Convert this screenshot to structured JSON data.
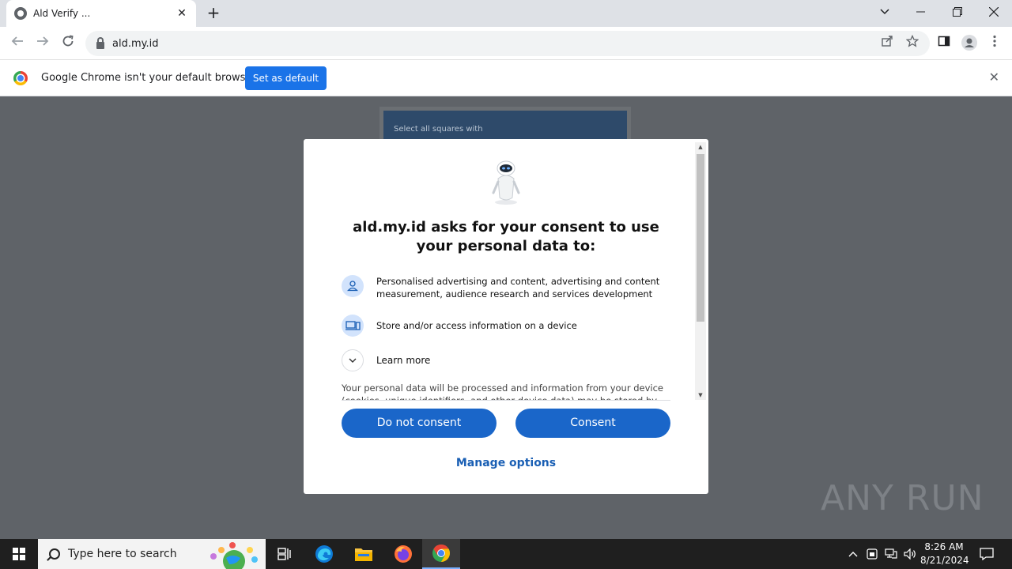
{
  "browser": {
    "tab_title": "Ald Verify ...",
    "tab_close": "✕",
    "new_tab": "+",
    "url": "ald.my.id"
  },
  "infobar": {
    "message": "Google Chrome isn't your default browser",
    "set_default_label": "Set as default",
    "close": "✕"
  },
  "background_page": {
    "captcha_prompt": "Select all squares with"
  },
  "consent_dialog": {
    "headline": "ald.my.id asks for your consent to use your personal data to:",
    "purposes": [
      {
        "icon": "person-icon",
        "text": "Personalised advertising and content, advertising and content measurement, audience research and services development"
      },
      {
        "icon": "device-icon",
        "text": "Store and/or access information on a device"
      }
    ],
    "learn_more_label": "Learn more",
    "body_text": "Your personal data will be processed and information from your device (cookies, unique identifiers, and other device data) may be stored by,",
    "do_not_consent_label": "Do not consent",
    "consent_label": "Consent",
    "manage_options_label": "Manage options"
  },
  "watermark": "ANY RUN",
  "taskbar": {
    "search_placeholder": "Type here to search",
    "time": "8:26 AM",
    "date": "8/21/2024"
  },
  "colors": {
    "accent": "#1a66c9",
    "page_overlay": "#5f6368",
    "infobar_button": "#1a73e8"
  }
}
